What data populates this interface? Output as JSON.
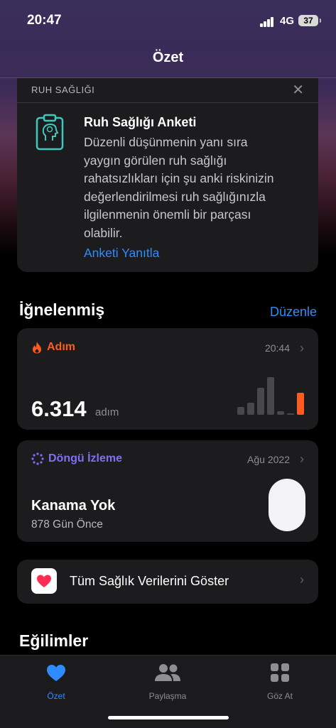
{
  "status_bar": {
    "time": "20:47",
    "network": "4G",
    "battery": "37"
  },
  "nav": {
    "title": "Özet"
  },
  "mental_health_card": {
    "header": "RUH SAĞLIĞI",
    "close_icon": "close-icon",
    "title": "Ruh Sağlığı Anketi",
    "body_lines": [
      "Düzenli düşünmenin yanı sıra",
      "yaygın görülen ruh sağlığı",
      "rahatsızlıkları için şu anki riskinizin",
      "değerlendirilmesi ruh sağlığınızla",
      "ilgilenmenin önemli bir parçası",
      "olabilir."
    ],
    "link": "Anketi Yanıtla"
  },
  "pinned": {
    "title": "İğnelenmiş",
    "edit": "Düzenle"
  },
  "steps_card": {
    "label": "Adım",
    "time": "20:44",
    "value": "6.314",
    "unit": "adım",
    "accent": "#ff5a1f",
    "bars": [
      0.18,
      0.28,
      0.62,
      0.85,
      0.08,
      0.02,
      0.5
    ]
  },
  "cycle_card": {
    "label": "Döngü İzleme",
    "date": "Ağu 2022",
    "main": "Kanama Yok",
    "sub": "878 Gün Önce",
    "accent": "#7f6ff5"
  },
  "all_data": {
    "label": "Tüm Sağlık Verilerini Göster"
  },
  "trends": {
    "title": "Eğilimler"
  },
  "tabs": [
    {
      "label": "Özet",
      "icon": "heart-icon",
      "active": true
    },
    {
      "label": "Paylaşma",
      "icon": "people-icon",
      "active": false
    },
    {
      "label": "Göz At",
      "icon": "grid-icon",
      "active": false
    }
  ]
}
